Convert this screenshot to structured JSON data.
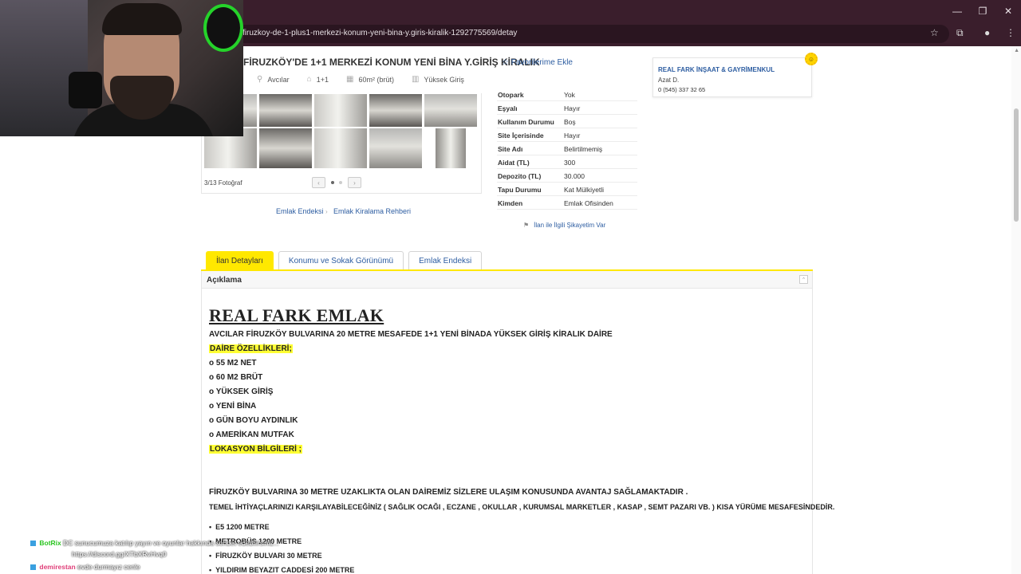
{
  "browser": {
    "url": "firuzkoy-de-1-plus1-merkezi-konum-yeni-bina-y.giris-kiralik-1292775569/detay",
    "window_controls": [
      "—",
      "❐",
      "✕"
    ]
  },
  "listing": {
    "title": "FİRUZKÖY'DE 1+1 MERKEZİ KONUM YENİ BİNA Y.GİRİŞ KİRALIK",
    "favorite_label": "Favorilerime Ekle",
    "meta": [
      {
        "icon": "location-pin-icon",
        "glyph": "⚲",
        "text": "Avcılar"
      },
      {
        "icon": "rooms-icon",
        "glyph": "⌂",
        "text": "1+1"
      },
      {
        "icon": "area-icon",
        "glyph": "▦",
        "text": "60m² (brüt)"
      },
      {
        "icon": "building-icon",
        "glyph": "▥",
        "text": "Yüksek Giriş"
      }
    ]
  },
  "agent": {
    "name": "REAL FARK İNŞAAT & GAYRİMENKUL",
    "person": "Azat D.",
    "phone": "0 (545) 337 32 65"
  },
  "gallery": {
    "photo_count": "3/13 Fotoğraf",
    "prev": "‹",
    "next": "›"
  },
  "links": {
    "index": "Emlak Endeksi",
    "guide": "Emlak Kiralama Rehberi",
    "complaint": "İlan ile İlgili Şikayetim Var"
  },
  "details": [
    {
      "label": "Otopark",
      "value": "Yok"
    },
    {
      "label": "Eşyalı",
      "value": "Hayır"
    },
    {
      "label": "Kullanım Durumu",
      "value": "Boş"
    },
    {
      "label": "Site İçerisinde",
      "value": "Hayır"
    },
    {
      "label": "Site Adı",
      "value": "Belirtilmemiş"
    },
    {
      "label": "Aidat (TL)",
      "value": "300"
    },
    {
      "label": "Depozito (TL)",
      "value": "30.000"
    },
    {
      "label": "Tapu Durumu",
      "value": "Kat Mülkiyetli"
    },
    {
      "label": "Kimden",
      "value": "Emlak Ofisinden"
    }
  ],
  "tabs": [
    {
      "label": "İlan Detayları",
      "active": true
    },
    {
      "label": "Konumu ve Sokak Görünümü",
      "active": false
    },
    {
      "label": "Emlak Endeksi",
      "active": false
    }
  ],
  "description": {
    "heading": "Açıklama",
    "brand": "REAL FARK EMLAK",
    "intro": "AVCILAR FİRUZKÖY BULVARINA 20 METRE MESAFEDE 1+1 YENİ BİNADA YÜKSEK GİRİŞ KİRALIK DAİRE",
    "features_title": "DAİRE ÖZELLİKLERİ;",
    "features": [
      "o 55 M2 NET",
      "o 60 M2 BRÜT",
      "o YÜKSEK GİRİŞ",
      "o YENİ BİNA",
      "o GÜN BOYU AYDINLIK",
      "o AMERİKAN MUTFAK"
    ],
    "location_title": "LOKASYON BİLGİLERİ ;",
    "location_text": "FİRUZKÖY BULVARINA 30 METRE UZAKLIKTA OLAN DAİREMİZ SİZLERE ULAŞIM KONUSUNDA AVANTAJ SAĞLAMAKTADIR .",
    "needs_text": "TEMEL İHTİYAÇLARINIZI KARŞILAYABİLECEĞİNİZ ( SAĞLIK OCAĞI , ECZANE , OKULLAR , KURUMSAL MARKETLER , KASAP , SEMT PAZARI VB. ) KISA YÜRÜME MESAFESİNDEDİR.",
    "distances": [
      "E5 1200 METRE",
      "METROBÜS 1200 METRE",
      "FİRUZKÖY BULVARI 30 METRE",
      "YILDIRIM BEYAZIT CADDESİ 200 METRE"
    ]
  },
  "chat": [
    {
      "user": "BotRix",
      "user_color": "#29c41f",
      "text": "DC sunucumuza katılıp yayın ve oyunlar hakkında sohbet edebilirsiniz..."
    },
    {
      "user": "",
      "user_color": "#ffffff",
      "text": "https://discord.gg/XTbXRvHvq0"
    },
    {
      "user": "demirestan",
      "user_color": "#e0407a",
      "text": "evde durmayız cenle"
    }
  ],
  "colors": {
    "accent_yellow": "#ffe800",
    "link_blue": "#2d5da1",
    "chrome_bg": "#3a1e2c"
  }
}
